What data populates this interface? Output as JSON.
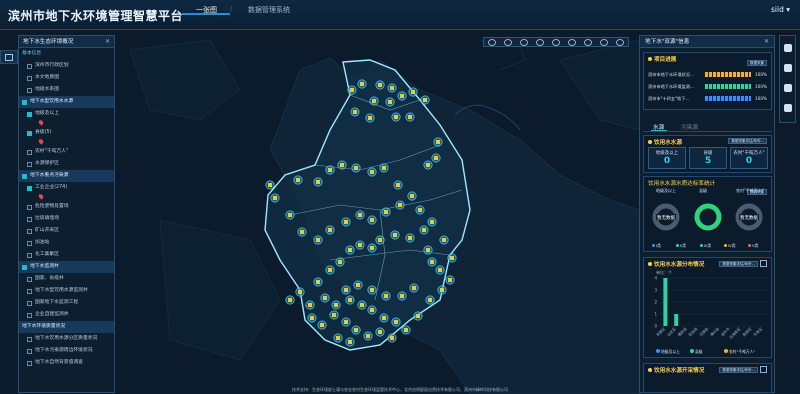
{
  "app": {
    "title": "滨州市地下水环境管理智慧平台"
  },
  "nav": {
    "tabs": [
      "一张图",
      "数据管理系统"
    ],
    "active": 0
  },
  "user": {
    "name": "siid",
    "caret": "▾"
  },
  "footer": {
    "text": "技术支持：生态环境部土壤与农业农村生态环境监管技术中心、北京启明星辰自然技术有限公司、滨州市峰岭科技有限公司"
  },
  "left_panel": {
    "title": "地下水生态环境概况",
    "close": "✕",
    "rows": [
      {
        "label": "基本信息",
        "type": "sec"
      },
      {
        "label": "滨州市行政区划",
        "type": "item",
        "checked": false
      },
      {
        "label": "水文地质图",
        "type": "item",
        "checked": false
      },
      {
        "label": "地级水系图",
        "type": "item",
        "checked": false
      },
      {
        "label": "地下水型饮用水水源",
        "type": "cat",
        "checked": true
      },
      {
        "label": "地级及以上",
        "type": "item",
        "checked": true
      },
      {
        "label": "",
        "type": "marker"
      },
      {
        "label": "县级(5)",
        "type": "item",
        "checked": true
      },
      {
        "label": "",
        "type": "marker"
      },
      {
        "label": "农村\"千吨万人\"",
        "type": "item",
        "checked": false
      },
      {
        "label": "水源保护区",
        "type": "item",
        "checked": false
      },
      {
        "label": "地下水重点污染源",
        "type": "cat",
        "checked": true
      },
      {
        "label": "工业企业(274)",
        "type": "item",
        "checked": true
      },
      {
        "label": "",
        "type": "marker"
      },
      {
        "label": "危险废物处置场",
        "type": "item",
        "checked": false
      },
      {
        "label": "垃圾填埋场",
        "type": "item",
        "checked": false
      },
      {
        "label": "矿山开采区",
        "type": "item",
        "checked": false
      },
      {
        "label": "加油站",
        "type": "item",
        "checked": false
      },
      {
        "label": "化工集聚区",
        "type": "item",
        "checked": false
      },
      {
        "label": "地下水监测井",
        "type": "cat",
        "checked": true
      },
      {
        "label": "国家、省级井",
        "type": "item",
        "checked": false
      },
      {
        "label": "地下水型饮用水源监测井",
        "type": "item",
        "checked": false
      },
      {
        "label": "国家地下水监测工程",
        "type": "item",
        "checked": false
      },
      {
        "label": "企业自建监测井",
        "type": "item",
        "checked": false
      },
      {
        "label": "地下水环境质量状况",
        "type": "cat2"
      },
      {
        "label": "地下水饮用水源分区质量状况",
        "type": "item",
        "checked": false
      },
      {
        "label": "地下水污染源周边环境状况",
        "type": "item",
        "checked": false
      },
      {
        "label": "地下水自然背景值调查",
        "type": "item",
        "checked": false
      }
    ]
  },
  "right_panel": {
    "title": "地下水\"双源\"信息",
    "close": "✕",
    "progress": {
      "title": "项目进展",
      "select": "数据采集",
      "items": [
        {
          "label": "滨州市地下水环境状况...",
          "pct": "100%",
          "value": 1.0,
          "color": "#f0b429"
        },
        {
          "label": "滨州市地下水环境监测...",
          "pct": "100%",
          "value": 1.0,
          "color": "#2fd3a0"
        },
        {
          "label": "滨州市\"十四五\"地下...",
          "pct": "100%",
          "value": 1.0,
          "color": "#3c8bff"
        }
      ]
    },
    "tabs": [
      "水源",
      "污染源"
    ],
    "drinking": {
      "title": "饮用水水源",
      "select": "数据采集评估/年份...",
      "stats": [
        {
          "name": "地级及以上",
          "value": "0"
        },
        {
          "name": "县级",
          "value": "5"
        },
        {
          "name": "农村\"千吨万人\"",
          "value": "0"
        }
      ]
    },
    "rate": {
      "title": "饮用水水源水质达标率统计",
      "select": "数据采集",
      "labels": [
        "地级及以上",
        "县级",
        "农村\"千吨万人\""
      ],
      "gauges": [
        {
          "text": "暂无数据",
          "value": null
        },
        {
          "text": "",
          "value": 1.0
        },
        {
          "text": "暂无数据",
          "value": null
        }
      ],
      "legend": [
        "I类",
        "II类",
        "III类",
        "IV类",
        "V类"
      ],
      "legend_colors": [
        "#3c8bff",
        "#22d3ee",
        "#2fd3a0",
        "#f0b429",
        "#ff5c5c"
      ]
    },
    "distribution": {
      "title": "饮用水水源分布情况",
      "select": "数据采集评估/年份...",
      "unit": "单位：个",
      "legend": [
        "地级及以上",
        "县级",
        "农村\"千吨万人\""
      ],
      "colors": [
        "#3c8bff",
        "#2fd3a0",
        "#f0b429"
      ]
    },
    "exploit": {
      "title": "饮用水水源开采情况",
      "select": "数据采集评估/年份..."
    }
  },
  "chart_data": {
    "type": "bar",
    "categories": [
      "滨城区",
      "沾化区",
      "惠民县",
      "阳信县",
      "无棣县",
      "博兴县",
      "邹平市",
      "北海新区",
      "高新区",
      "开发区"
    ],
    "series": [
      {
        "name": "县级",
        "values": [
          4,
          1,
          0,
          0,
          0,
          0,
          0,
          0,
          0,
          0
        ]
      }
    ],
    "ylim": [
      0,
      4
    ],
    "yticks": [
      0,
      1,
      2,
      3,
      4
    ],
    "ylabel": "单位：个"
  }
}
